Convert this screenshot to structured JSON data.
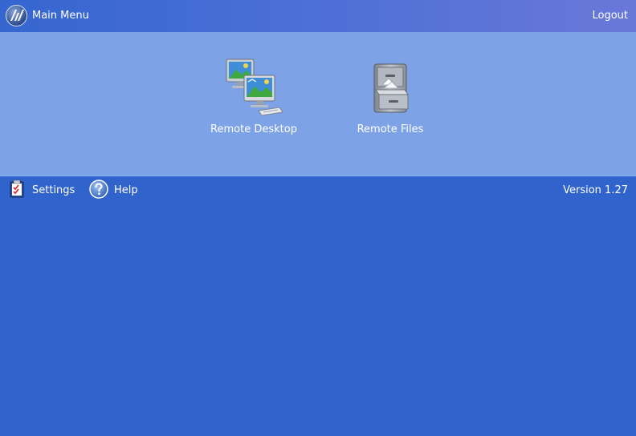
{
  "header": {
    "title": "Main Menu",
    "logout_label": "Logout",
    "logo_icon": "app-logo-icon"
  },
  "launcher": {
    "apps": [
      {
        "label": "Remote Desktop",
        "icon": "remote-desktop-icon"
      },
      {
        "label": "Remote Files",
        "icon": "file-cabinet-icon"
      }
    ]
  },
  "toolbar": {
    "settings_label": "Settings",
    "settings_icon": "settings-checklist-icon",
    "help_label": "Help",
    "help_icon": "help-icon",
    "version": "Version 1.27"
  },
  "colors": {
    "header_start": "#3566cf",
    "header_end": "#6a78d8",
    "panel": "#7da3e6",
    "background": "#3063cb"
  }
}
